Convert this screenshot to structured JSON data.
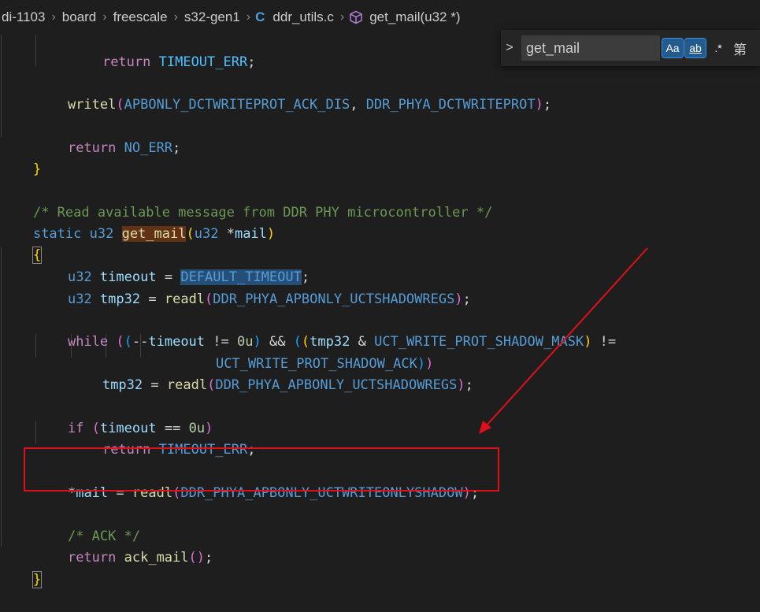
{
  "breadcrumb": {
    "items": [
      "di-1103",
      "board",
      "freescale",
      "s32-gen1",
      "ddr_utils.c",
      "get_mail(u32 *)"
    ],
    "file_icon": "C",
    "symbol_icon": "method-cube-icon"
  },
  "find_widget": {
    "value": "get_mail",
    "toggle_label": ">",
    "match_case_label": "Aa",
    "whole_word_label": "ab",
    "regex_label": ".*",
    "result_text": "第"
  },
  "code": {
    "l1": [
      "return",
      "TIMEOUT_ERR",
      ";"
    ],
    "l2": [
      "writel",
      "(",
      "APBONLY_DCTWRITEPROT_ACK_DIS",
      ", ",
      "DDR_PHYA_DCTWRITEPROT",
      ")",
      ";"
    ],
    "l3": [
      "return",
      "NO_ERR",
      ";"
    ],
    "l4": [
      "}"
    ],
    "l5": [
      "/* Read available message from DDR PHY microcontroller */"
    ],
    "l6": [
      "static",
      "u32",
      "get_mail",
      "(",
      "u32",
      "*",
      "mail",
      ")"
    ],
    "l7": [
      "{"
    ],
    "l8": [
      "u32",
      "timeout",
      "=",
      "DEFAULT_TIMEOUT",
      ";"
    ],
    "l9": [
      "u32",
      "tmp32",
      "=",
      "readl",
      "(",
      "DDR_PHYA_APBONLY_UCTSHADOWREGS",
      ")",
      ";"
    ],
    "l10": [
      "while",
      "(",
      "(",
      "--",
      "timeout",
      " != ",
      "0u",
      ")",
      " && ",
      "(",
      "(",
      "tmp32",
      " & ",
      "UCT_WRITE_PROT_SHADOW_MASK",
      ")",
      " !="
    ],
    "l11": [
      "UCT_WRITE_PROT_SHADOW_ACK",
      ")",
      ")"
    ],
    "l12": [
      "tmp32",
      "=",
      "readl",
      "(",
      "DDR_PHYA_APBONLY_UCTSHADOWREGS",
      ")",
      ";"
    ],
    "l13": [
      "if",
      "(",
      "timeout",
      "==",
      "0u",
      ")"
    ],
    "l14": [
      "return",
      "TIMEOUT_ERR",
      ";"
    ],
    "l15": [
      "*",
      "mail",
      "=",
      "readl",
      "(",
      "DDR_PHYA_APBONLY_UCTWRITEONLYSHADOW",
      ")",
      ";"
    ],
    "l16": [
      "/* ACK */"
    ],
    "l17": [
      "return",
      "ack_mail",
      "(",
      ")",
      ";"
    ],
    "l18": [
      "}"
    ]
  },
  "colors": {
    "annotation": "#e0101a",
    "background": "#1e1e1e",
    "keyword": "#569cd6",
    "function": "#dcdcaa",
    "comment": "#6a9955"
  }
}
